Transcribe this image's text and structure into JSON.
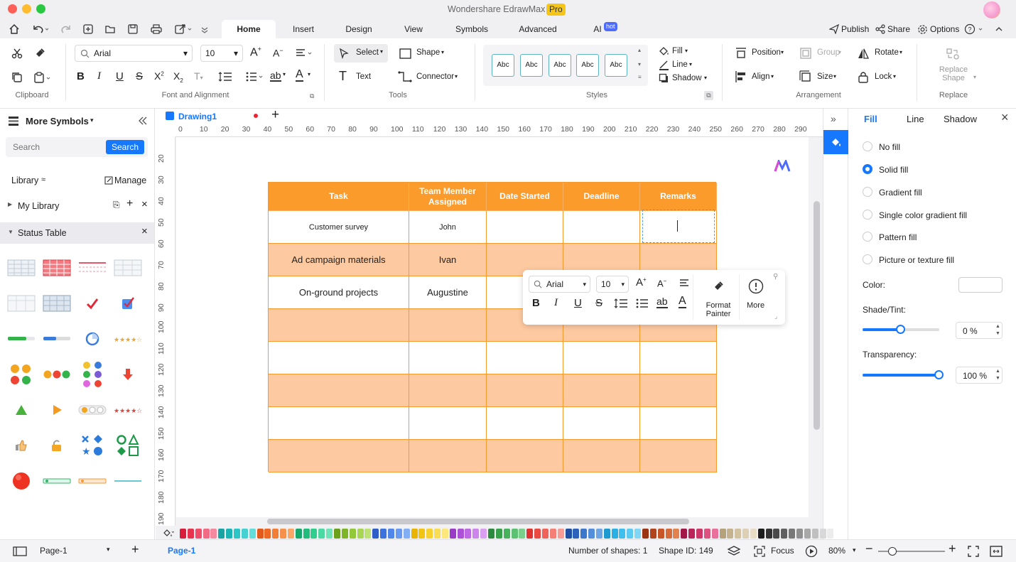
{
  "app": {
    "title": "Wondershare EdrawMax",
    "badge": "Pro"
  },
  "menu": {
    "tabs": [
      "Home",
      "Insert",
      "Design",
      "View",
      "Symbols",
      "Advanced",
      "AI"
    ],
    "ai_badge": "hot",
    "right": {
      "publish": "Publish",
      "share": "Share",
      "options": "Options"
    }
  },
  "ribbon": {
    "groups": {
      "clipboard": "Clipboard",
      "font": "Font and Alignment",
      "tools": "Tools",
      "styles": "Styles",
      "arrangement": "Arrangement",
      "replace": "Replace"
    },
    "font_name": "Arial",
    "font_size": "10",
    "select": "Select",
    "shape": "Shape",
    "text": "Text",
    "connector": "Connector",
    "style_samples": [
      "Abc",
      "Abc",
      "Abc",
      "Abc",
      "Abc"
    ],
    "fill": "Fill",
    "line": "Line",
    "shadow": "Shadow",
    "position": "Position",
    "group": "Group",
    "rotate": "Rotate",
    "align": "Align",
    "size": "Size",
    "lock": "Lock",
    "replace_shape": "Replace Shape"
  },
  "left_panel": {
    "title": "More Symbols",
    "search_placeholder": "Search",
    "search_button": "Search",
    "library": "Library",
    "manage": "Manage",
    "my_library": "My Library",
    "status_table": "Status Table"
  },
  "document": {
    "tab": "Drawing1"
  },
  "ruler": {
    "h": [
      "0",
      "10",
      "20",
      "30",
      "40",
      "50",
      "60",
      "70",
      "80",
      "90",
      "100",
      "110",
      "120",
      "130",
      "140",
      "150",
      "160",
      "170",
      "180",
      "190",
      "200",
      "210",
      "220",
      "230",
      "240",
      "250",
      "260",
      "270",
      "280",
      "290"
    ],
    "v": [
      "20",
      "30",
      "40",
      "50",
      "60",
      "70",
      "80",
      "90",
      "100",
      "110",
      "120",
      "130",
      "140",
      "150",
      "160",
      "170",
      "180",
      "190"
    ]
  },
  "table": {
    "headers": [
      "Task",
      "Team Member Assigned",
      "Date Started",
      "Deadline",
      "Remarks"
    ],
    "rows": [
      [
        "Customer survey",
        "John",
        "",
        "",
        ""
      ],
      [
        "Ad campaign materials",
        "Ivan",
        "",
        "",
        ""
      ],
      [
        "On-ground projects",
        "Augustine",
        "",
        "",
        ""
      ],
      [
        "",
        "",
        "",
        "",
        ""
      ],
      [
        "",
        "",
        "",
        "",
        ""
      ],
      [
        "",
        "",
        "",
        "",
        ""
      ],
      [
        "",
        "",
        "",
        "",
        ""
      ],
      [
        "",
        "",
        "",
        "",
        ""
      ]
    ]
  },
  "float_toolbar": {
    "font": "Arial",
    "size": "10",
    "format_painter": "Format Painter",
    "more": "More"
  },
  "right_panel": {
    "tabs": [
      "Fill",
      "Line",
      "Shadow"
    ],
    "options": [
      "No fill",
      "Solid fill",
      "Gradient fill",
      "Single color gradient fill",
      "Pattern fill",
      "Picture or texture fill"
    ],
    "selected": 1,
    "color_label": "Color:",
    "shade_label": "Shade/Tint:",
    "shade_value": "0 %",
    "shade_level": 0.5,
    "transparency_label": "Transparency:",
    "transparency_value": "100 %",
    "transparency_level": 1.0
  },
  "status": {
    "page_selector": "Page-1",
    "page_tab": "Page-1",
    "shapes": "Number of shapes: 1",
    "shape_id": "Shape ID: 149",
    "focus": "Focus",
    "zoom": "80%"
  },
  "colors": {
    "accent": "#1677ff",
    "header_orange": "#fb9b2c",
    "row_peach": "#fdc9a0",
    "palette": [
      "#d81e3a",
      "#e8334f",
      "#ef4d6a",
      "#f26b85",
      "#f5899f",
      "#1aa3a3",
      "#1cb5b5",
      "#2cc6c6",
      "#45d1d1",
      "#63dcdc",
      "#e25a1c",
      "#ec6a25",
      "#f27d34",
      "#f6914c",
      "#f9a666",
      "#16a86b",
      "#1fbc7c",
      "#2fce8e",
      "#4ad9a2",
      "#6fe3b8",
      "#6aa01a",
      "#7db525",
      "#93c838",
      "#a8d653",
      "#bde273",
      "#2f5ec8",
      "#3c72dd",
      "#4f86ea",
      "#679af0",
      "#82aff4",
      "#e8b400",
      "#f2c412",
      "#f7d22d",
      "#f9dd52",
      "#fbe77a",
      "#9b3cc8",
      "#ad50d8",
      "#be68e3",
      "#cd84eb",
      "#db9ff1",
      "#2b8a3e",
      "#37a14c",
      "#46b35c",
      "#5cc170",
      "#7acf8b",
      "#e0322e",
      "#ea4a42",
      "#f0635a",
      "#f47f76",
      "#f79c95",
      "#1f4fa3",
      "#2b63ba",
      "#3b78cc",
      "#528eda",
      "#6ea5e5",
      "#1d9bd1",
      "#29afe4",
      "#3fbfee",
      "#5ccbf2",
      "#7fd7f5",
      "#9a3412",
      "#b3431a",
      "#c75526",
      "#d66a38",
      "#e2824f",
      "#a31648",
      "#bb2459",
      "#cf376b",
      "#de5282",
      "#e9709a",
      "#b5a27a",
      "#c4b38e",
      "#d1c2a1",
      "#ddd0b4",
      "#e8dcc7",
      "#1c1c1c",
      "#333333",
      "#4a4a4a",
      "#606060",
      "#787878",
      "#909090",
      "#a8a8a8",
      "#c0c0c0",
      "#d8d8d8",
      "#ececec"
    ]
  }
}
